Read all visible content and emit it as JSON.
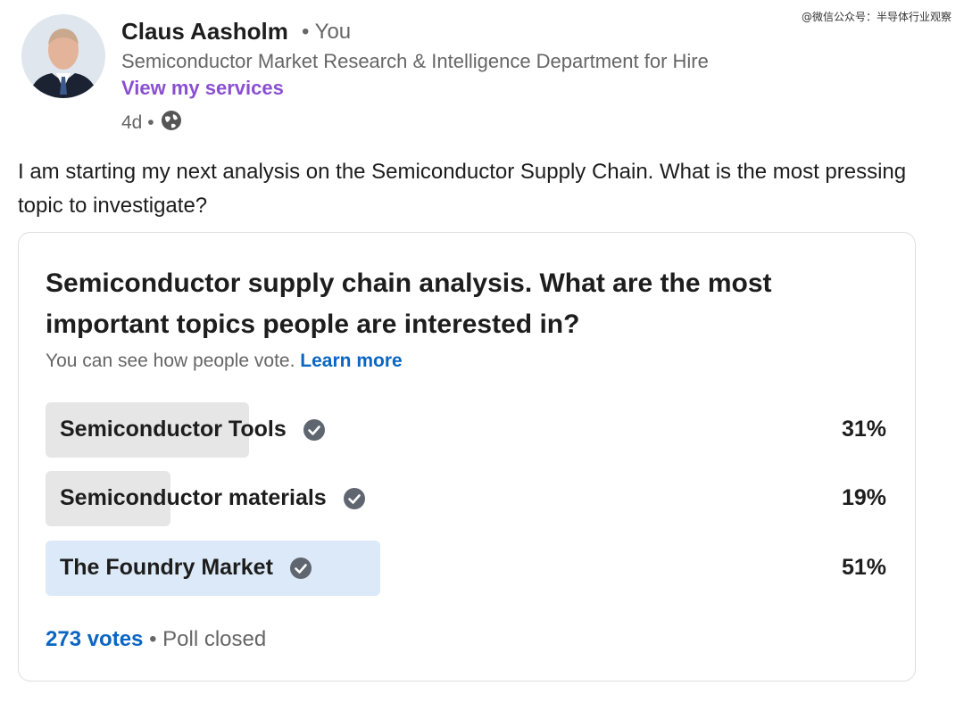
{
  "watermark": "@微信公众号：半导体行业观察",
  "post": {
    "author_name": "Claus Aasholm",
    "author_badge": "• You",
    "headline": "Semiconductor Market Research & Intelligence Department for Hire",
    "services_link": "View my services",
    "time": "4d •",
    "text": "I am starting my next analysis on the Semiconductor Supply Chain. What is the most pressing topic to investigate?"
  },
  "poll": {
    "question": "Semiconductor supply chain analysis. What are the most important topics people are interested in?",
    "hint": "You can see how people vote.",
    "learn_more": "Learn more",
    "options": [
      {
        "label": "Semiconductor Tools",
        "percent": "31%",
        "value": 31
      },
      {
        "label": "Semiconductor materials",
        "percent": "19%",
        "value": 19
      },
      {
        "label": "The Foundry Market",
        "percent": "51%",
        "value": 51
      }
    ],
    "votes": "273 votes",
    "status": "• Poll closed"
  },
  "colors": {
    "fill_default": "#e6e6e6",
    "fill_leading": "#dce9f8",
    "accent": "#0a66c2",
    "services": "#8a4fd1"
  }
}
